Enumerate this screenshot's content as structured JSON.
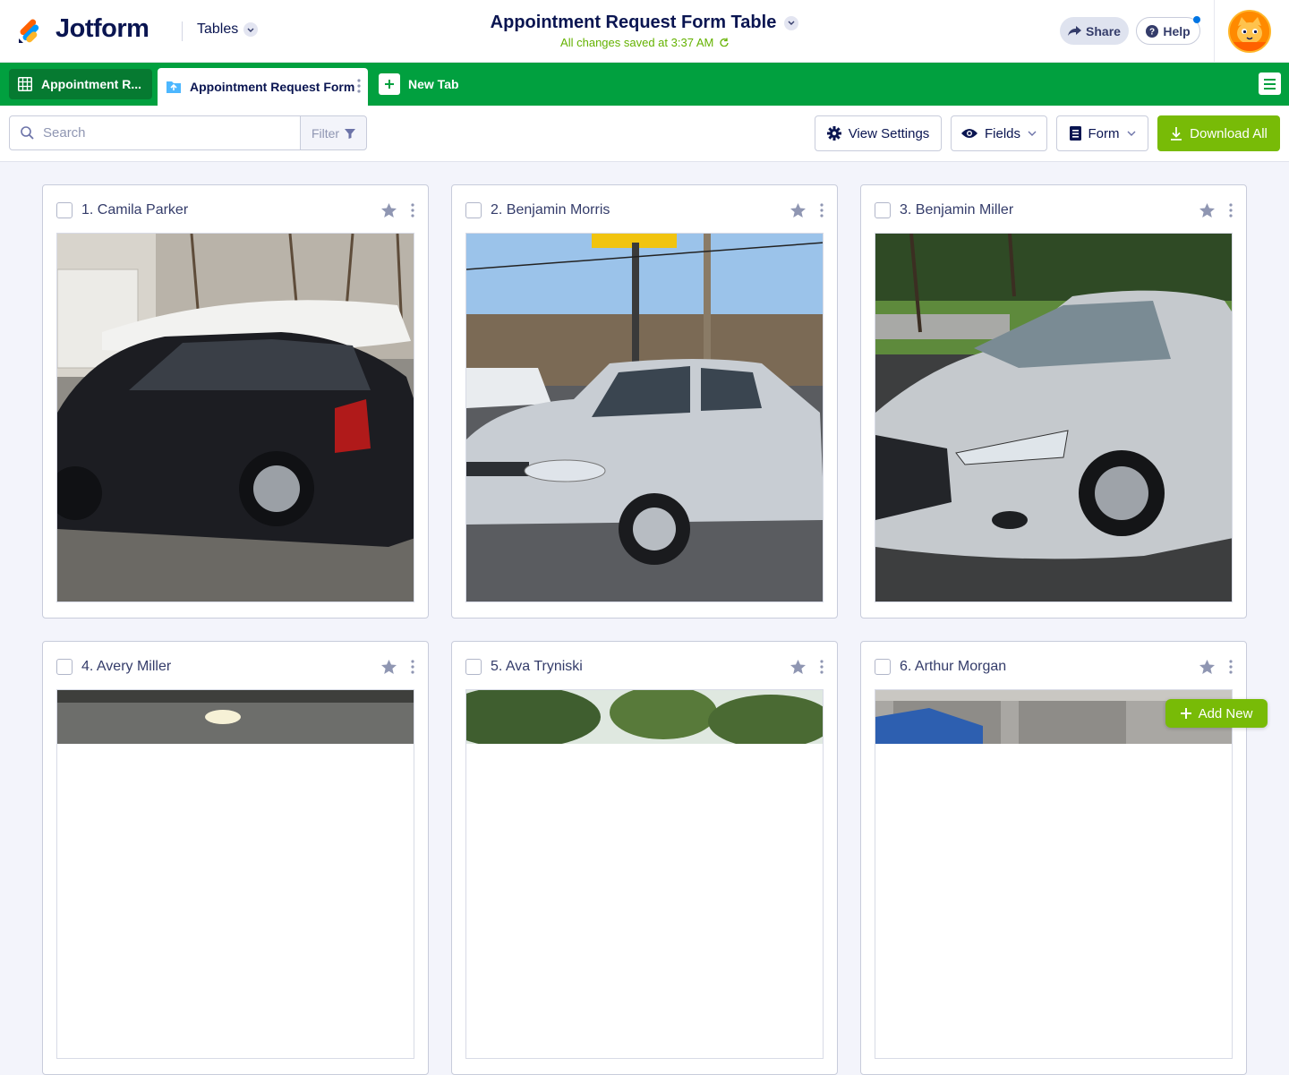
{
  "header": {
    "brand": "Jotform",
    "tables_label": "Tables",
    "title": "Appointment Request Form Table",
    "save_status": "All changes saved at 3:37 AM",
    "share_label": "Share",
    "help_label": "Help"
  },
  "tabs": {
    "items": [
      {
        "label": "Appointment R...",
        "icon": "grid-icon",
        "active": false
      },
      {
        "label": "Appointment Request Form",
        "icon": "form-tab-icon",
        "active": true
      }
    ],
    "new_tab_label": "New Tab"
  },
  "toolbar": {
    "search_placeholder": "Search",
    "filter_label": "Filter",
    "view_settings_label": "View Settings",
    "fields_label": "Fields",
    "form_label": "Form",
    "download_label": "Download All"
  },
  "cards": [
    {
      "name": "1. Camila Parker",
      "photo": "black hatchback car"
    },
    {
      "name": "2. Benjamin Morris",
      "photo": "silver sedan car"
    },
    {
      "name": "3. Benjamin Miller",
      "photo": "silver sedan car front"
    },
    {
      "name": "4. Avery Miller",
      "photo": "garage interior"
    },
    {
      "name": "5. Ava Tryniski",
      "photo": "trees"
    },
    {
      "name": "6. Arthur Morgan",
      "photo": "blue car in garage"
    }
  ],
  "add_new_label": "Add New",
  "colors": {
    "brand_green": "#01a03f",
    "action_green": "#78bb07",
    "navy": "#0a1551",
    "saved_green": "#64b200"
  }
}
